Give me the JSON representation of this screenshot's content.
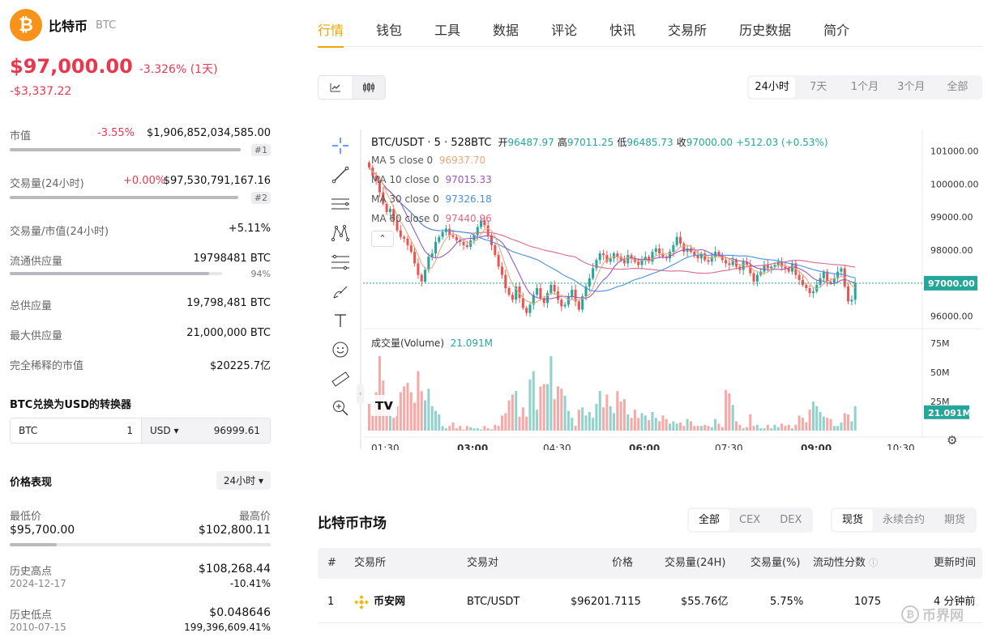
{
  "coin": {
    "name": "比特币",
    "symbol": "BTC",
    "price": "$97,000.00",
    "change_pct": "-3.326% (1天)",
    "change_abs": "-$3,337.22"
  },
  "stats": {
    "market_cap": {
      "label": "市值",
      "pct": "-3.55%",
      "value": "$1,906,852,034,585.00",
      "rank": "#1",
      "bar_fraction": 1.0
    },
    "volume": {
      "label": "交易量(24小时)",
      "pct": "+0.00%",
      "value": "$97,530,791,167.16",
      "rank": "#2",
      "bar_fraction": 1.0
    },
    "vol_mcap": {
      "label": "交易量/市值(24小时)",
      "value": "+5.11%"
    },
    "circulating": {
      "label": "流通供应量",
      "value": "19798481 BTC",
      "percent": "94%",
      "bar_fraction": 0.94
    },
    "total_supply": {
      "label": "总供应量",
      "value": "19,798,481 BTC"
    },
    "max_supply": {
      "label": "最大供应量",
      "value": "21,000,000 BTC"
    },
    "fdv": {
      "label": "完全稀释的市值",
      "value": "$20225.7亿"
    }
  },
  "converter": {
    "title": "BTC兑换为USD的转换器",
    "from_symbol": "BTC",
    "from_amount": "1",
    "to_symbol": "USD ▾",
    "to_amount": "96999.61"
  },
  "performance": {
    "title": "价格表现",
    "period": "24小时 ▾",
    "low_label": "最低价",
    "low_value": "$95,700.00",
    "high_label": "最高价",
    "high_value": "$102,800.11",
    "ath_label": "历史高点",
    "ath_value": "$108,268.44",
    "ath_date": "2024-12-17",
    "ath_change": "-10.41%",
    "atl_label": "历史低点",
    "atl_value": "$0.048646",
    "atl_date": "2010-07-15",
    "atl_change": "199,396,609.41%"
  },
  "nav": {
    "tabs": [
      "行情",
      "钱包",
      "工具",
      "数据",
      "评论",
      "快讯",
      "交易所",
      "历史数据",
      "简介"
    ],
    "active": 0
  },
  "chart_controls": {
    "toggle_line_icon": "line-chart-icon",
    "toggle_candle_icon": "candlestick-icon",
    "time_tabs": [
      "24小时",
      "7天",
      "1个月",
      "3个月",
      "全部"
    ],
    "active_time": 0
  },
  "chart_overlay": {
    "pair": "BTC/USDT · 5 · 528BTC",
    "open_label": "开",
    "open": "96487.97",
    "high_label": "高",
    "high": "97011.25",
    "low_label": "低",
    "low": "96485.73",
    "close_label": "收",
    "close": "97000.00",
    "change": "+512.03 (+0.53%)",
    "ma5_label": "MA 5 close 0",
    "ma5": "96937.70",
    "ma10_label": "MA 10 close 0",
    "ma10": "97015.33",
    "ma30_label": "MA 30 close 0",
    "ma30": "97326.18",
    "ma60_label": "MA 60 close 0",
    "ma60": "97440.96",
    "volume_label": "成交量(Volume)",
    "volume_value": "21.091M",
    "current_price_tag": "97000.00",
    "current_volume_tag": "21.091M"
  },
  "colors": {
    "up": "#26a69a",
    "down": "#ef5350",
    "ma5": "#e8a87c",
    "ma10": "#9b59b6",
    "ma30": "#4a90e2",
    "ma60": "#d96a8a",
    "accent": "#f0a500"
  },
  "chart_data": {
    "type": "candlestick",
    "price_axis_ticks": [
      "101000.00",
      "100000.00",
      "99000.00",
      "98000.00",
      "97000.00",
      "96000.00"
    ],
    "price_range": [
      95650,
      101650
    ],
    "volume_axis_ticks": [
      "75M",
      "50M",
      "25M"
    ],
    "time_ticks": [
      "01:30",
      "03:00",
      "04:30",
      "06:00",
      "07:30",
      "09:00",
      "10:30"
    ],
    "close": [
      100500,
      100250,
      100100,
      99750,
      99400,
      99150,
      99250,
      98900,
      98600,
      98400,
      98350,
      98150,
      97950,
      97600,
      97250,
      97050,
      97400,
      97800,
      97900,
      98250,
      98400,
      98550,
      98650,
      98450,
      98400,
      98300,
      98250,
      98150,
      98100,
      98300,
      98450,
      98700,
      98900,
      98750,
      98450,
      98150,
      97850,
      97500,
      97250,
      96850,
      96650,
      96500,
      96900,
      96550,
      96250,
      96100,
      96350,
      96650,
      96850,
      96550,
      96400,
      96700,
      96950,
      96750,
      96500,
      96300,
      96350,
      96600,
      96800,
      96450,
      96200,
      96600,
      96900,
      97150,
      97450,
      97700,
      97900,
      97850,
      97650,
      97750,
      97900,
      97800,
      97700,
      97600,
      97850,
      97750,
      97650,
      97550,
      97700,
      97800,
      97650,
      97950,
      98050,
      97900,
      97800,
      97750,
      97950,
      98150,
      98400,
      98200,
      97950,
      98050,
      97950,
      97850,
      97750,
      97900,
      97700,
      97650,
      97800,
      97950,
      97850,
      97700,
      97600,
      97550,
      97700,
      97500,
      97400,
      97650,
      97550,
      97300,
      97050,
      97250,
      97350,
      97550,
      97450,
      97500,
      97550,
      97650,
      97500,
      97450,
      97350,
      97600,
      97250,
      97100,
      96950,
      96850,
      96700,
      96750,
      96950,
      97150,
      97350,
      97050,
      97000,
      97150,
      97350,
      97450,
      96900,
      96450,
      96500,
      97000
    ],
    "volume_millions": [
      23,
      13,
      33,
      64,
      43,
      26,
      14,
      11,
      21,
      33,
      38,
      41,
      33,
      24,
      51,
      34,
      26,
      36,
      21,
      17,
      14,
      4,
      2,
      4,
      7,
      2,
      4,
      1,
      4,
      3,
      2,
      2,
      1,
      4,
      2,
      1,
      5,
      4,
      13,
      15,
      26,
      31,
      34,
      12,
      20,
      12,
      44,
      51,
      18,
      38,
      40,
      40,
      64,
      27,
      38,
      36,
      30,
      17,
      11,
      4,
      18,
      20,
      13,
      16,
      11,
      23,
      34,
      20,
      31,
      21,
      15,
      34,
      25,
      27,
      14,
      11,
      18,
      11,
      15,
      13,
      9,
      16,
      11,
      8,
      13,
      10,
      6,
      8,
      6,
      7,
      4,
      10,
      8,
      4,
      4,
      4,
      5,
      4,
      3,
      10,
      6,
      3,
      35,
      32,
      22,
      8,
      5,
      2,
      3,
      14,
      4,
      5,
      2,
      2,
      5,
      2,
      5,
      3,
      6,
      4,
      5,
      2,
      5,
      13,
      11,
      7,
      18,
      25,
      21,
      16,
      12,
      11,
      10,
      4,
      4,
      7,
      15,
      14,
      8,
      21
    ]
  },
  "market": {
    "title": "比特币市场",
    "type_tabs": [
      "全部",
      "CEX",
      "DEX"
    ],
    "active_type": 0,
    "kind_tabs": [
      "现货",
      "永续合约",
      "期货"
    ],
    "active_kind": 0,
    "headers": [
      "#",
      "交易所",
      "交易对",
      "价格",
      "交易量(24H)",
      "交易量(%)",
      "流动性分数",
      "更新时间"
    ],
    "rows": [
      {
        "rank": "1",
        "exchange": "币安网",
        "pair": "BTC/USDT",
        "price": "$96201.7115",
        "volume": "$55.76亿",
        "volume_pct": "5.75%",
        "liquidity": "1075",
        "updated": "4 分钟前"
      }
    ]
  },
  "watermark": {
    "text": "币界网",
    "icon": "b-coin-logo-icon"
  }
}
